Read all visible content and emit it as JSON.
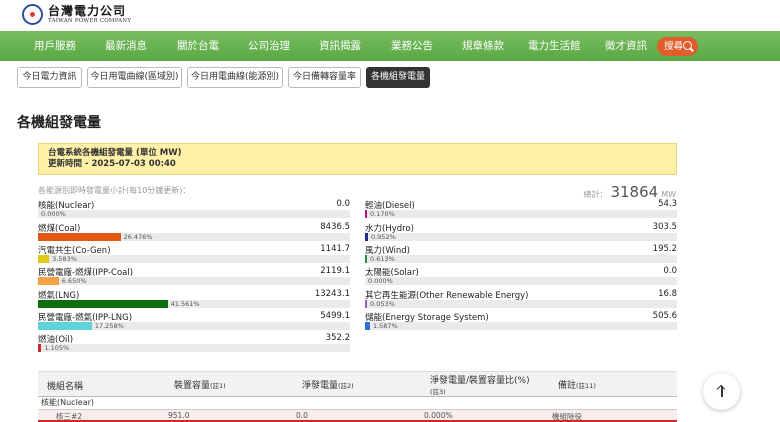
{
  "site": {
    "name_cn": "台灣電力公司",
    "name_en": "TAIWAN POWER COMPANY"
  },
  "nav": {
    "items": [
      "用戶服務",
      "最新消息",
      "關於台電",
      "公司治理",
      "資訊揭露",
      "業務公告",
      "規章條款",
      "電力生活館",
      "徵才資訊"
    ],
    "search_label": "搜尋"
  },
  "tabs": [
    "今日電力資訊",
    "今日用電曲線(區域別)",
    "今日用電曲線(能源別)",
    "今日備轉容量率",
    "各機組發電量"
  ],
  "active_tab": 4,
  "page_title": "各機組發電量",
  "notice": {
    "line1": "台電系統各機組發電量 (單位 MW)",
    "line2": "更新時間 - 2025-07-03 00:40"
  },
  "summary": {
    "subtitle": "各能源別即時發電量小計(每10分鐘更新)：",
    "total_label": "總計：",
    "total_value": "31864",
    "total_unit": "MW"
  },
  "sources_left": [
    {
      "name": "核能(Nuclear)",
      "value": "0.0",
      "pct_label": "0.000%",
      "pct": 0.0,
      "color": "#f0a0a0"
    },
    {
      "name": "燃煤(Coal)",
      "value": "8436.5",
      "pct_label": "26.476%",
      "pct": 26.476,
      "color": "#e05a12"
    },
    {
      "name": "汽電共生(Co-Gen)",
      "value": "1141.7",
      "pct_label": "3.583%",
      "pct": 3.583,
      "color": "#e0c91a"
    },
    {
      "name": "民營電廠-燃煤(IPP-Coal)",
      "value": "2119.1",
      "pct_label": "6.650%",
      "pct": 6.65,
      "color": "#f4a248"
    },
    {
      "name": "燃氣(LNG)",
      "value": "13243.1",
      "pct_label": "41.561%",
      "pct": 41.561,
      "color": "#0d6e0d"
    },
    {
      "name": "民營電廠-燃氣(IPP-LNG)",
      "value": "5499.1",
      "pct_label": "17.258%",
      "pct": 17.258,
      "color": "#5ed3d8"
    },
    {
      "name": "燃油(Oil)",
      "value": "352.2",
      "pct_label": "1.105%",
      "pct": 1.105,
      "color": "#c9272c"
    }
  ],
  "sources_right": [
    {
      "name": "輕油(Diesel)",
      "value": "54.3",
      "pct_label": "0.170%",
      "pct": 0.17,
      "color": "#b21c7a"
    },
    {
      "name": "水力(Hydro)",
      "value": "303.5",
      "pct_label": "0.952%",
      "pct": 0.952,
      "color": "#1c2f8f"
    },
    {
      "name": "風力(Wind)",
      "value": "195.2",
      "pct_label": "0.613%",
      "pct": 0.613,
      "color": "#2e8b3a"
    },
    {
      "name": "太陽能(Solar)",
      "value": "0.0",
      "pct_label": "0.000%",
      "pct": 0.0,
      "color": "#f3c41a"
    },
    {
      "name": "其它再生能源(Other Renewable Energy)",
      "value": "16.8",
      "pct_label": "0.053%",
      "pct": 0.053,
      "color": "#8a5fc7"
    },
    {
      "name": "儲能(Energy Storage System)",
      "value": "505.6",
      "pct_label": "1.587%",
      "pct": 1.587,
      "color": "#2f6fd1"
    }
  ],
  "table": {
    "headers": [
      {
        "label": "機組名稱",
        "note": ""
      },
      {
        "label": "裝置容量",
        "note": "(註1)"
      },
      {
        "label": "淨發電量",
        "note": "(註2)"
      },
      {
        "label": "淨發電量/裝置容量比(%)",
        "note": "(註3)"
      },
      {
        "label": "備註",
        "note": "(註11)"
      }
    ],
    "group": "核能(Nuclear)",
    "row": [
      "核三#2",
      "951.0",
      "0.0",
      "0.000%",
      "機組除役"
    ]
  }
}
